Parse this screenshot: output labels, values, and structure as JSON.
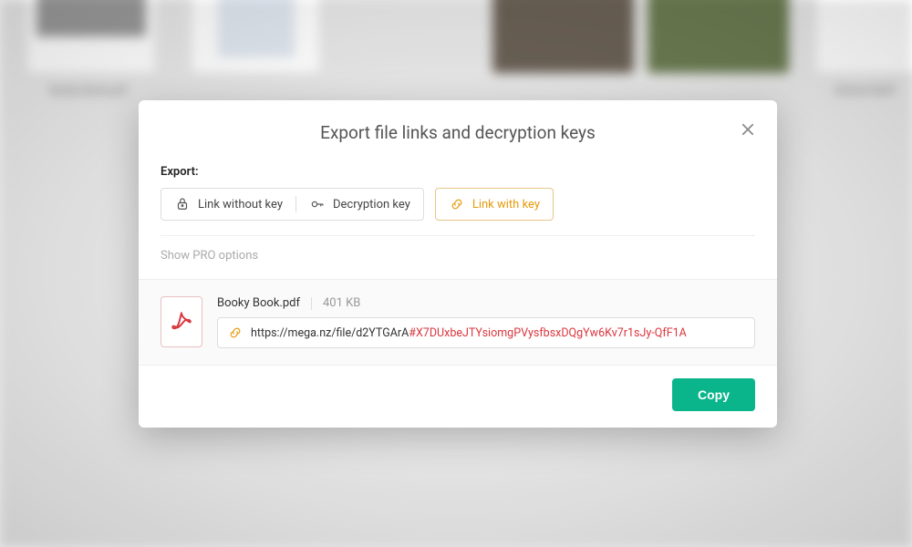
{
  "dialog": {
    "title": "Export file links and decryption keys",
    "export_label": "Export:",
    "options": {
      "link_without_key": "Link without key",
      "decryption_key": "Decryption key",
      "link_with_key": "Link with key"
    },
    "pro_options": "Show PRO options",
    "file": {
      "name": "Booky Book.pdf",
      "size": "401 KB",
      "link_base": "https://mega.nz/file/d2YTGArA",
      "link_key": "#X7DUxbeJTYsiomgPVysfbsxDQgYw6Kv7r1sJy-QfF1A"
    },
    "copy_button": "Copy"
  },
  "bg_captions": {
    "left": "Booky Book.pdf",
    "right": "School Stuff"
  }
}
